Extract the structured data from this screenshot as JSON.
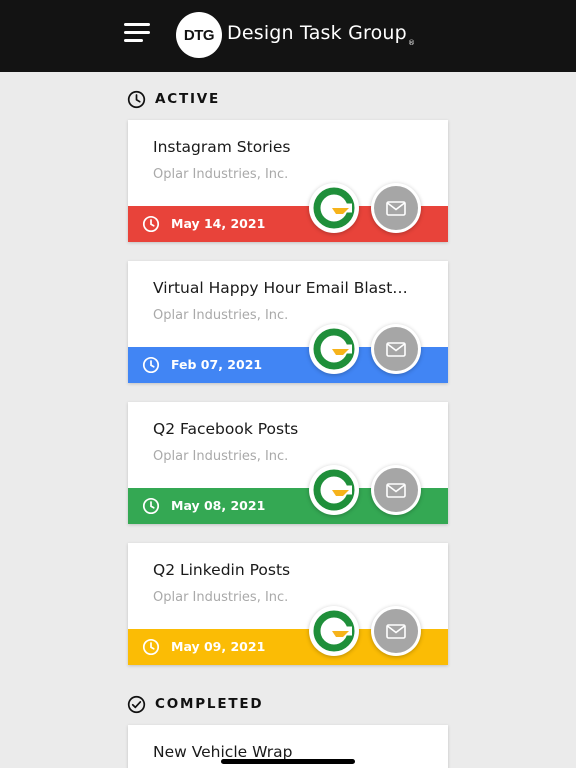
{
  "header": {
    "logo_text": "DTG",
    "brand_name": "Design Task Group",
    "brand_mark": "®",
    "icons": {
      "menu": "hamburger-menu-icon"
    },
    "colors": {
      "background": "#131313",
      "text": "#ffffff"
    }
  },
  "sections": [
    {
      "label": "ACTIVE",
      "icon": "clock-icon"
    },
    {
      "label": "COMPLETED",
      "icon": "check-circle-icon"
    }
  ],
  "active_tasks": [
    {
      "title": "Instagram Stories",
      "company": "Oplar Industries, Inc.",
      "due_date": "May 14, 2021",
      "color": "#e8433a",
      "client_icon": "client-logo-icon",
      "action_icon": "mail-icon"
    },
    {
      "title": "Virtual Happy Hour Email Blast…",
      "company": "Oplar Industries, Inc.",
      "due_date": "Feb 07, 2021",
      "color": "#4185f4",
      "client_icon": "client-logo-icon",
      "action_icon": "mail-icon"
    },
    {
      "title": "Q2 Facebook Posts",
      "company": "Oplar Industries, Inc.",
      "due_date": "May 08, 2021",
      "color": "#34a853",
      "client_icon": "client-logo-icon",
      "action_icon": "mail-icon"
    },
    {
      "title": "Q2 Linkedin Posts",
      "company": "Oplar Industries, Inc.",
      "due_date": "May 09, 2021",
      "color": "#fbbc05",
      "client_icon": "client-logo-icon",
      "action_icon": "mail-icon"
    }
  ],
  "completed_tasks": [
    {
      "title": "New Vehicle Wrap"
    }
  ],
  "colors": {
    "page_background": "#ebebeb",
    "card_background": "#ffffff",
    "muted_text": "#a9a9a9",
    "mail_button": "#a6a6a6"
  }
}
